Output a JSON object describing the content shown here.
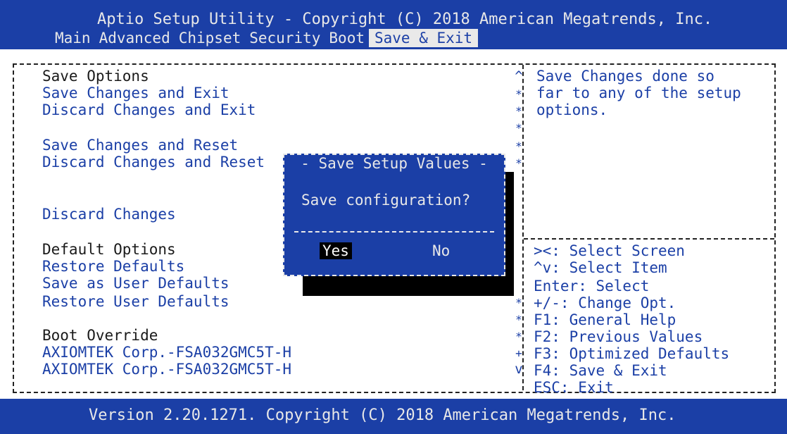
{
  "header": {
    "title": "Aptio Setup Utility - Copyright (C) 2018 American Megatrends, Inc.",
    "tabs": [
      {
        "label": "Main"
      },
      {
        "label": "Advanced"
      },
      {
        "label": "Chipset"
      },
      {
        "label": "Security"
      },
      {
        "label": "Boot"
      },
      {
        "label": "Save & Exit",
        "active": true
      }
    ]
  },
  "menu": {
    "save_options_heading": "Save Options",
    "save_changes_and_exit": "Save Changes and Exit",
    "discard_changes_and_exit": "Discard Changes and Exit",
    "save_changes_and_reset": "Save Changes and Reset",
    "discard_changes_and_reset": "Discard Changes and Reset",
    "save_changes": "Save Changes",
    "discard_changes": "Discard Changes",
    "default_options_heading": "Default Options",
    "restore_defaults": "Restore Defaults",
    "save_as_user_defaults": "Save as User Defaults",
    "restore_user_defaults": "Restore User Defaults",
    "boot_override_heading": "Boot Override",
    "boot_device_1": "AXIOMTEK Corp.-FSA032GMC5T-H",
    "boot_device_2": "AXIOMTEK Corp.-FSA032GMC5T-H",
    "selected_item": "Save Changes"
  },
  "help": {
    "lines": [
      "Save Changes done so",
      "far to any of the setup",
      "options."
    ]
  },
  "nav_keys": [
    "><: Select Screen",
    "^v: Select Item",
    "Enter: Select",
    "+/-: Change Opt.",
    "F1: General Help",
    "F2: Previous Values",
    "F3: Optimized Defaults",
    "F4: Save & Exit",
    "ESC: Exit"
  ],
  "dialog": {
    "title": "Save Setup Values",
    "prompt": "Save configuration?",
    "yes_label": "Yes",
    "no_label": "No",
    "focused_button": "Yes"
  },
  "footer": {
    "text": "Version 2.20.1271. Copyright (C) 2018 American Megatrends, Inc."
  },
  "colors": {
    "bios_blue": "#1b3fa6",
    "text_light": "#e8e8e8",
    "text_dark": "#1a1a1a",
    "selection_white": "#ffffff",
    "shadow": "#000000"
  }
}
